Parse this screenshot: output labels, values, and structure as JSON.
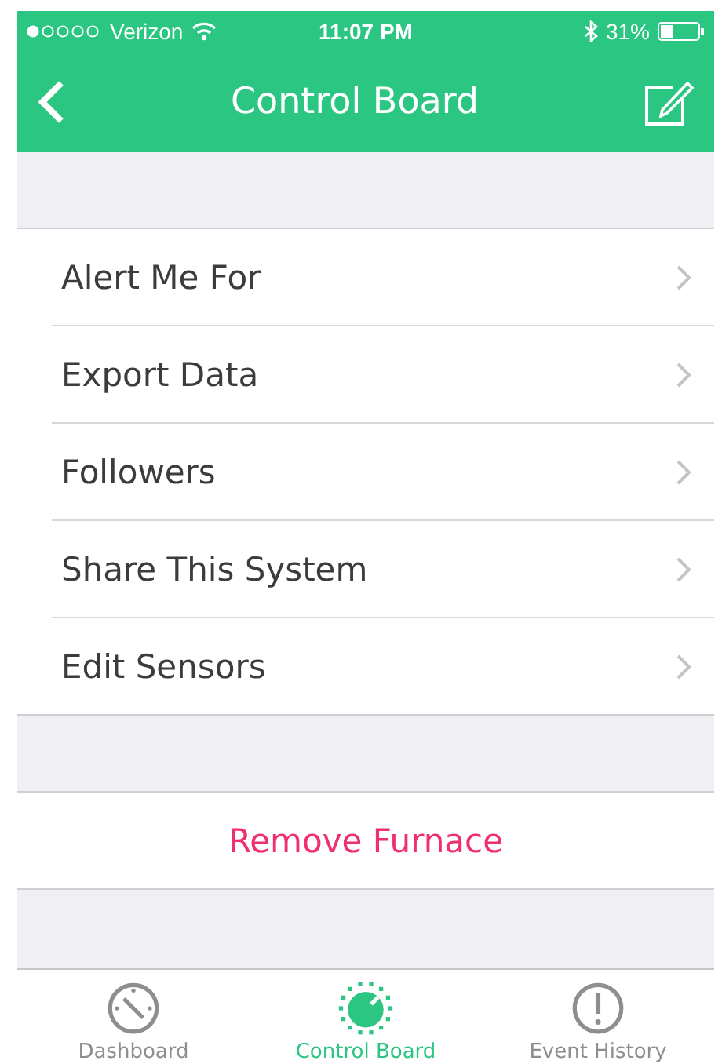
{
  "status_bar": {
    "carrier": "Verizon",
    "time": "11:07 PM",
    "battery": "31%"
  },
  "nav": {
    "title": "Control Board"
  },
  "menu": [
    {
      "label": "Alert Me For"
    },
    {
      "label": "Export Data"
    },
    {
      "label": "Followers"
    },
    {
      "label": "Share This System"
    },
    {
      "label": "Edit Sensors"
    }
  ],
  "action": {
    "label": "Remove Furnace"
  },
  "tabs": [
    {
      "label": "Dashboard",
      "kind": "gauge",
      "selected": false
    },
    {
      "label": "Control Board",
      "kind": "dial",
      "selected": true
    },
    {
      "label": "Event History",
      "kind": "alert",
      "selected": false
    }
  ]
}
